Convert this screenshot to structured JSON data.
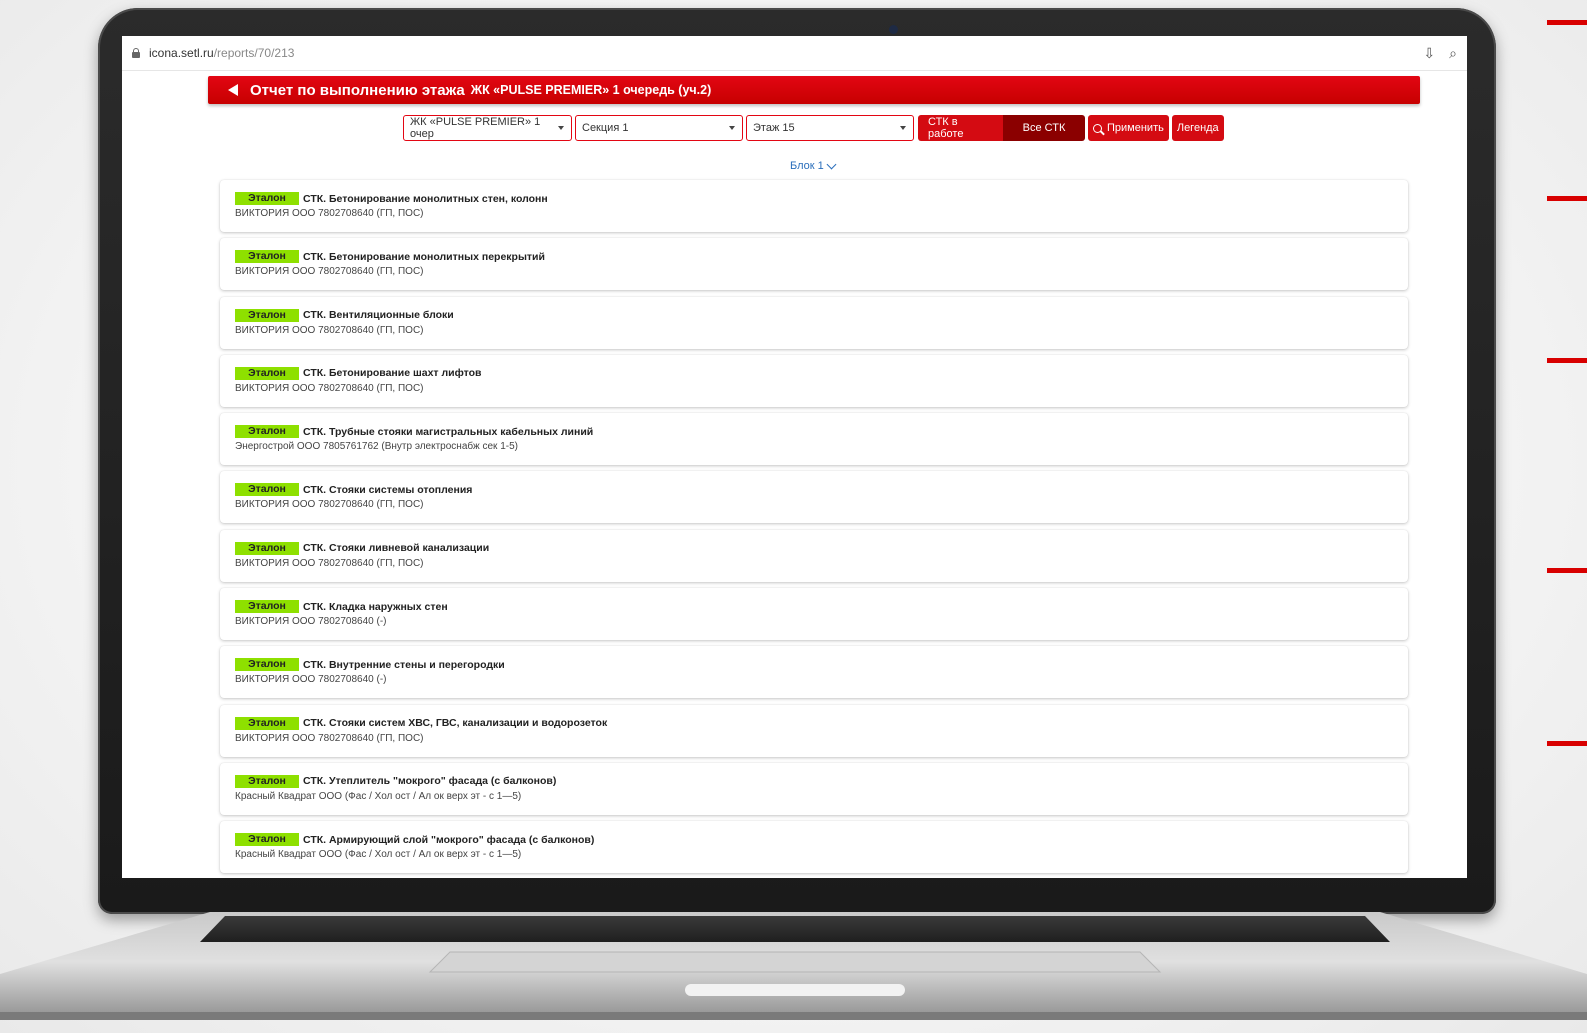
{
  "browser": {
    "url_host": "icona.setl.ru",
    "url_path": "/reports/70/213"
  },
  "header": {
    "title": "Отчет по выполнению этажа",
    "subtitle": "ЖК «PULSE PREMIER» 1 очередь (уч.2)"
  },
  "filters": {
    "complex": "ЖК «PULSE PREMIER» 1 очер",
    "section": "Секция 1",
    "floor": "Этаж 15",
    "toggle_active": "СТК в работе",
    "toggle_all": "Все СТК",
    "apply": "Применить",
    "legend": "Легенда"
  },
  "block_label": "Блок 1",
  "items": [
    {
      "badge": "Эталон",
      "title": "СТК. Бетонирование монолитных стен, колонн",
      "sub": "ВИКТОРИЯ ООО 7802708640 (ГП, ПОС)"
    },
    {
      "badge": "Эталон",
      "title": "СТК. Бетонирование монолитных перекрытий",
      "sub": "ВИКТОРИЯ ООО 7802708640 (ГП, ПОС)"
    },
    {
      "badge": "Эталон",
      "title": "СТК. Вентиляционные блоки",
      "sub": "ВИКТОРИЯ ООО 7802708640 (ГП, ПОС)"
    },
    {
      "badge": "Эталон",
      "title": "СТК. Бетонирование шахт лифтов",
      "sub": "ВИКТОРИЯ ООО 7802708640 (ГП, ПОС)"
    },
    {
      "badge": "Эталон",
      "title": "СТК. Трубные стояки магистральных кабельных линий",
      "sub": "Энергострой ООО 7805761762 (Внутр электроснабж сек 1-5)"
    },
    {
      "badge": "Эталон",
      "title": "СТК. Стояки системы отопления",
      "sub": "ВИКТОРИЯ ООО 7802708640 (ГП, ПОС)"
    },
    {
      "badge": "Эталон",
      "title": "СТК. Стояки ливневой канализации",
      "sub": "ВИКТОРИЯ ООО 7802708640 (ГП, ПОС)"
    },
    {
      "badge": "Эталон",
      "title": "СТК. Кладка наружных стен",
      "sub": "ВИКТОРИЯ ООО 7802708640 (-)"
    },
    {
      "badge": "Эталон",
      "title": "СТК. Внутренние стены и перегородки",
      "sub": "ВИКТОРИЯ ООО 7802708640 (-)"
    },
    {
      "badge": "Эталон",
      "title": "СТК. Стояки систем ХВС, ГВС, канализации и водорозеток",
      "sub": "ВИКТОРИЯ ООО 7802708640 (ГП, ПОС)"
    },
    {
      "badge": "Эталон",
      "title": "СТК. Утеплитель \"мокрого\" фасада (с балконов)",
      "sub": "Красный Квадрат ООО (Фас / Хол ост / Ал ок верх эт - с 1—5)"
    },
    {
      "badge": "Эталон",
      "title": "СТК. Армирующий слой \"мокрого\" фасада (с балконов)",
      "sub": "Красный Квадрат ООО (Фас / Хол ост / Ал ок верх эт - с 1—5)"
    }
  ],
  "colors": {
    "brand_red": "#e30613",
    "dark_red": "#8b0000",
    "badge_green": "#8ee000",
    "link_blue": "#2a6ebb"
  },
  "icons": [
    "lock-icon",
    "download-icon",
    "zoom-icon",
    "back-arrow-icon",
    "search-icon",
    "chevron-down-icon"
  ]
}
